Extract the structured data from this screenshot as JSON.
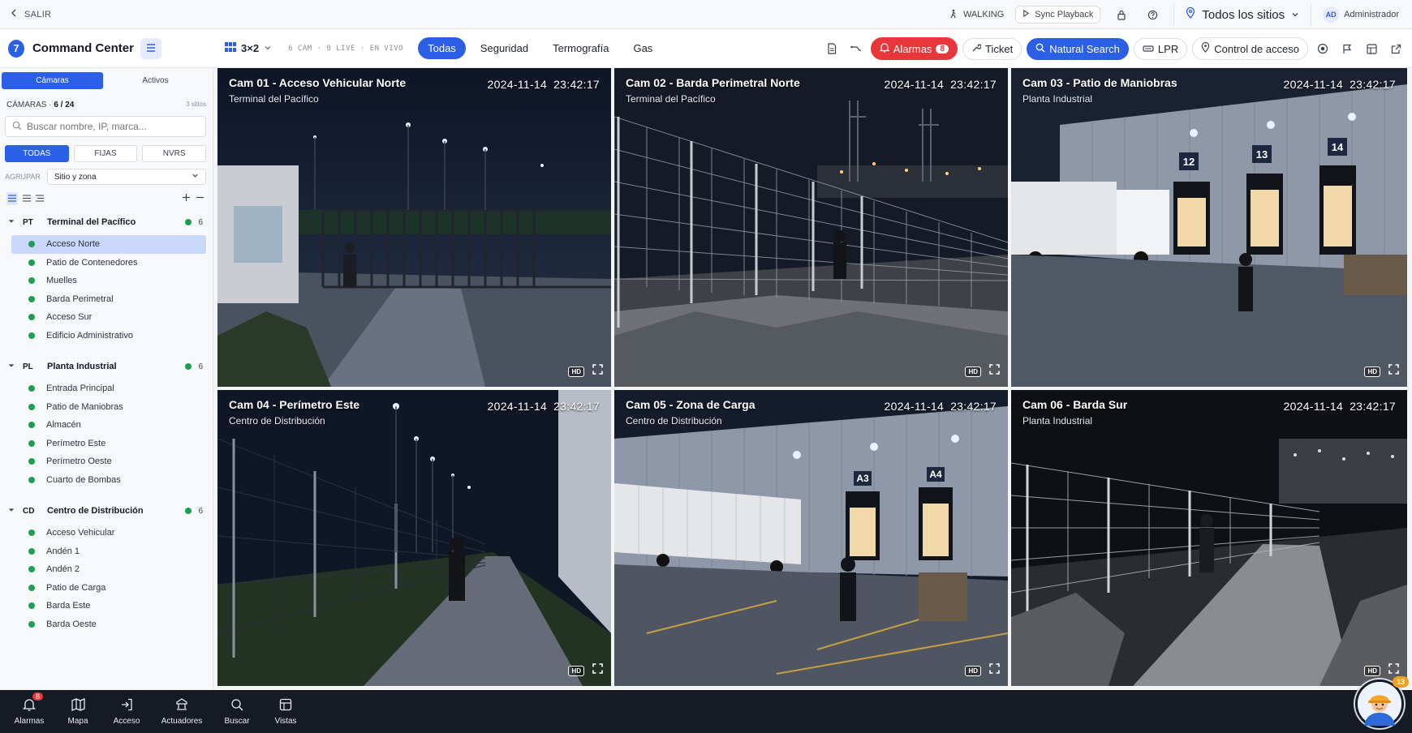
{
  "topbar": {
    "exit_label": "SALIR",
    "walking_label": "WALKING",
    "sync_label": "Sync Playback",
    "sites_label": "Todos los sitios",
    "user_initials": "AD",
    "user_name": "Administrador"
  },
  "nav": {
    "app_number": "7",
    "app_name": "Command Center",
    "layout": "3×2",
    "counts": "6 CÁM · 0 LIVE · EN VIVO",
    "tabs": [
      {
        "label": "Todas",
        "active": true
      },
      {
        "label": "Seguridad"
      },
      {
        "label": "Termografía"
      },
      {
        "label": "Gas"
      }
    ],
    "alarms_label": "Alarmas",
    "alarms_count": "8",
    "ticket_label": "Ticket",
    "natural_search_label": "Natural Search",
    "lpr_label": "LPR",
    "access_label": "Control de acceso"
  },
  "sidebar": {
    "tabs": [
      "Cámaras",
      "Activos"
    ],
    "heading": "CÁMARAS",
    "count": "6 / 24",
    "sites_count": "3 sitios",
    "search_placeholder": "Buscar nombre, IP, marca...",
    "filters": [
      "TODAS",
      "FIJAS",
      "NVRS"
    ],
    "group_label": "AGRUPAR",
    "group_value": "Sitio y zona",
    "sites": [
      {
        "abbr": "PT",
        "name": "Terminal del Pacífico",
        "count": "6",
        "items": [
          "Acceso Norte",
          "Patio de Contenedores",
          "Muelles",
          "Barda Perimetral",
          "Acceso Sur",
          "Edificio Administrativo"
        ]
      },
      {
        "abbr": "PL",
        "name": "Planta Industrial",
        "count": "6",
        "items": [
          "Entrada Principal",
          "Patio de Maniobras",
          "Almacén",
          "Perímetro Este",
          "Perímetro Oeste",
          "Cuarto de Bombas"
        ]
      },
      {
        "abbr": "CD",
        "name": "Centro de Distribución",
        "count": "6",
        "items": [
          "Acceso Vehicular",
          "Andén 1",
          "Andén 2",
          "Patio de Carga",
          "Barda Este",
          "Barda Oeste"
        ]
      }
    ]
  },
  "cameras": [
    {
      "title": "Cam 01 - Acceso Vehicular Norte",
      "site": "Terminal del Pacífico",
      "date": "2024-11-14",
      "time": "23:42:17"
    },
    {
      "title": "Cam 02 - Barda Perimetral Norte",
      "site": "Terminal del Pacífico",
      "date": "2024-11-14",
      "time": "23:42:17"
    },
    {
      "title": "Cam 03 - Patio de Maniobras",
      "site": "Planta Industrial",
      "date": "2024-11-14",
      "time": "23:42:17"
    },
    {
      "title": "Cam 04 - Perímetro Este",
      "site": "Centro de Distribución",
      "date": "2024-11-14",
      "time": "23:42:17"
    },
    {
      "title": "Cam 05 - Zona de Carga",
      "site": "Centro de Distribución",
      "date": "2024-11-14",
      "time": "23:42:17"
    },
    {
      "title": "Cam 06 - Barda Sur",
      "site": "Planta Industrial",
      "date": "2024-11-14",
      "time": "23:42:17"
    }
  ],
  "tile_controls": {
    "hd": "HD"
  },
  "dock_labels": {
    "a12": "12",
    "a13": "13",
    "a14": "14",
    "a3": "A3",
    "a4": "A4"
  },
  "bottombar": {
    "items": [
      "Alarmas",
      "Mapa",
      "Acceso",
      "Actuadores",
      "Buscar",
      "Vistas"
    ],
    "alarm_badge": "8",
    "assistant_badge": "13"
  },
  "colors": {
    "accent": "#2a5fe6",
    "alarm": "#e8363b",
    "online": "#1f9d55"
  }
}
